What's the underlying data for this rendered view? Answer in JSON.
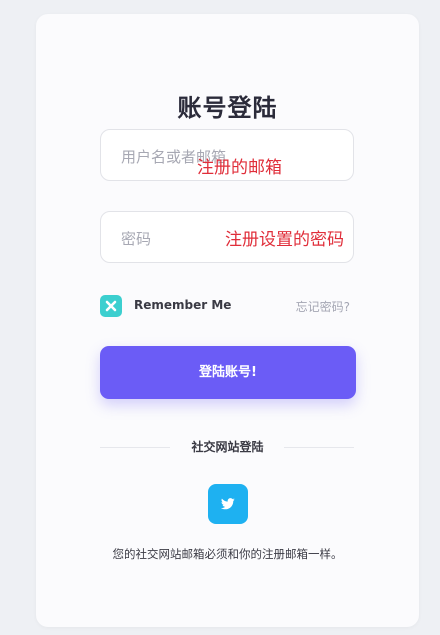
{
  "login": {
    "title": "账号登陆",
    "username_placeholder": "用户名或者邮箱",
    "username_annotation": "注册的邮箱",
    "password_placeholder": "密码",
    "password_annotation": "注册设置的密码",
    "remember_label": "Remember Me",
    "remember_checked": true,
    "forgot_label": "忘记密码?",
    "submit_label": "登陆账号!"
  },
  "social": {
    "divider_label": "社交网站登陆",
    "twitter_icon": "twitter-icon",
    "note": "您的社交网站邮箱必须和你的注册邮箱一样。"
  },
  "colors": {
    "accent": "#6b5cf6",
    "checkbox": "#3ccfcf",
    "twitter": "#1eb1f1",
    "annotation": "#e02e3a"
  }
}
